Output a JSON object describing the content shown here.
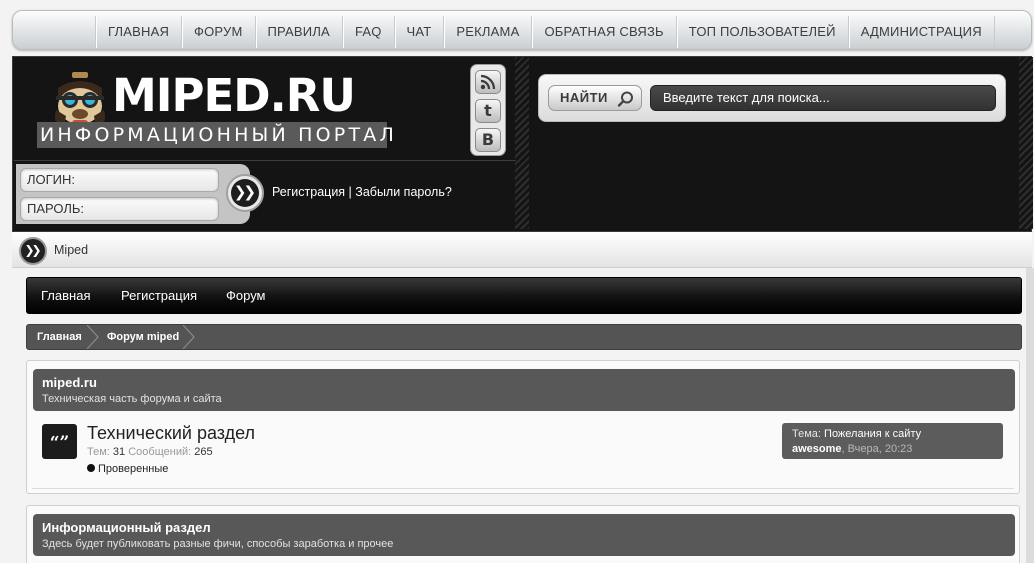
{
  "topnav": {
    "items": [
      {
        "label": "ГЛАВНАЯ"
      },
      {
        "label": "ФОРУМ"
      },
      {
        "label": "ПРАВИЛА"
      },
      {
        "label": "FAQ"
      },
      {
        "label": "ЧАТ"
      },
      {
        "label": "РЕКЛАМА"
      },
      {
        "label": "ОБРАТНАЯ СВЯЗЬ"
      },
      {
        "label": "ТОП ПОЛЬЗОВАТЕЛЕЙ"
      },
      {
        "label": "АДМИНИСТРАЦИЯ"
      }
    ]
  },
  "header": {
    "logo_title": "MIPED.RU",
    "logo_subtitle": "ИНФОРМАЦИОННЫЙ ПОРТАЛ",
    "social": [
      {
        "icon": "rss-icon"
      },
      {
        "icon": "tumblr-icon",
        "glyph": "t"
      },
      {
        "icon": "vk-icon",
        "glyph": "B"
      }
    ],
    "login_placeholder": "ЛОГИН:",
    "password_placeholder": "ПАРОЛЬ:",
    "register_link": "Регистрация",
    "separator": " | ",
    "forgot_link": "Забыли пароль?",
    "search_button": "НАЙТИ",
    "search_placeholder": "Введите текст для поиска..."
  },
  "breadcrumb": {
    "label": "Miped"
  },
  "forum_nav": {
    "items": [
      "Главная",
      "Регистрация",
      "Форум"
    ]
  },
  "forum_crumbs": {
    "items": [
      "Главная",
      "Форум miped"
    ]
  },
  "categories": [
    {
      "title": "miped.ru",
      "description": "Техническая часть форума и сайта",
      "forums": [
        {
          "icon_glyph": "“”",
          "title": "Технический раздел",
          "topics_label": "Тем:",
          "topics": "31",
          "posts_label": "Сообщений:",
          "posts": "265",
          "subforum": "Проверенные",
          "last_post": {
            "prefix": "Тема:",
            "topic": "Пожелания к сайту",
            "author": "awesome",
            "time": "Вчера, 20:23"
          }
        }
      ]
    },
    {
      "title": "Информационный раздел",
      "description": "Здесь будет публиковать разные фичи, способы заработка и прочее"
    }
  ]
}
